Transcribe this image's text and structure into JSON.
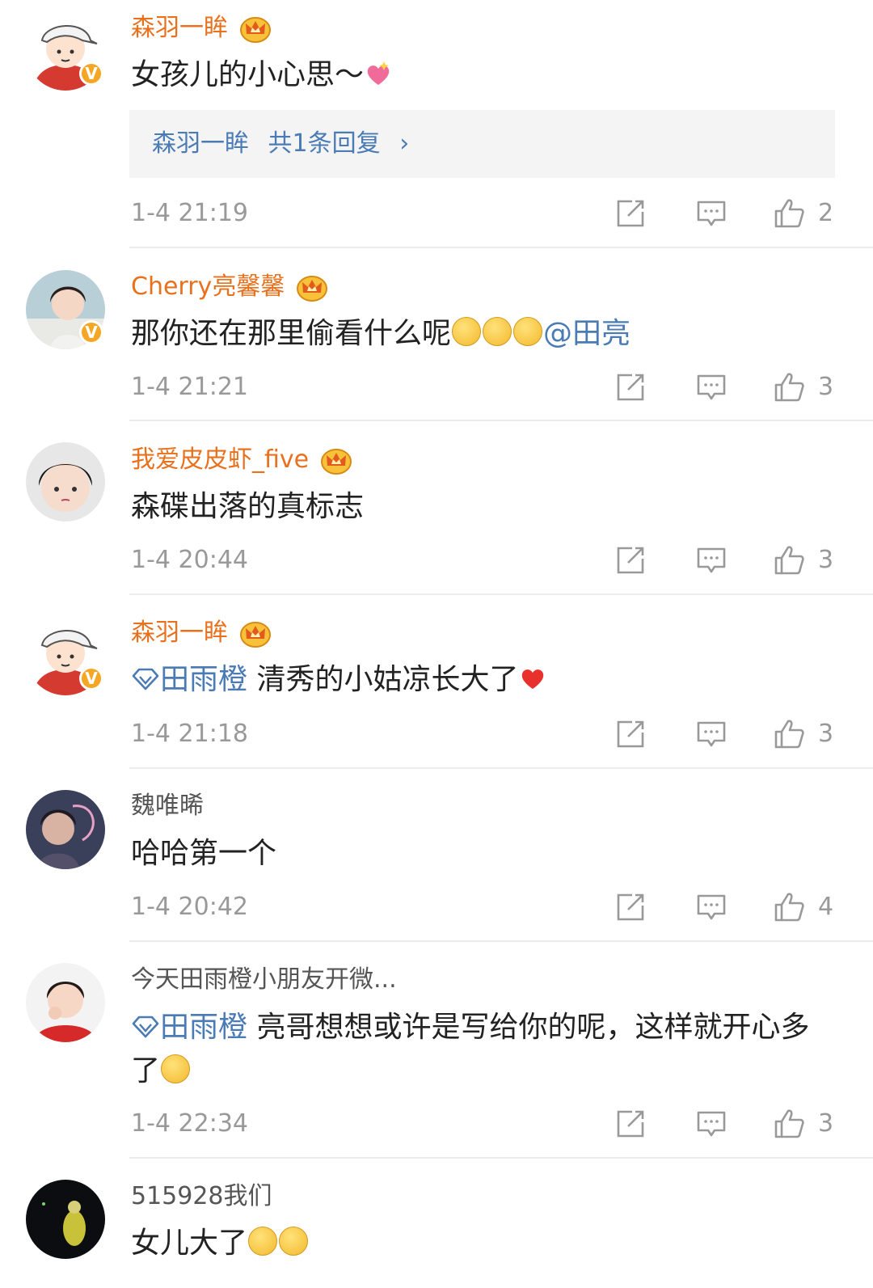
{
  "comments": [
    {
      "name": "森羽一眸",
      "vip": true,
      "text": "女孩儿的小心思～",
      "reply_author": "森羽一眸",
      "reply_count_label": "共1条回复",
      "time": "1-4 21:19",
      "likes": "2"
    },
    {
      "name": "Cherry亮馨馨",
      "vip": true,
      "text": "那你还在那里偷看什么呢",
      "mention": "@田亮",
      "time": "1-4 21:21",
      "likes": "3"
    },
    {
      "name": "我爱皮皮虾_five",
      "vip": true,
      "text": "森碟出落的真标志",
      "time": "1-4 20:44",
      "likes": "3"
    },
    {
      "name": "森羽一眸",
      "vip": true,
      "mention": "田雨橙",
      "text": " 清秀的小姑凉长大了",
      "time": "1-4 21:18",
      "likes": "3"
    },
    {
      "name": "魏唯晞",
      "vip": false,
      "text": "哈哈第一个",
      "time": "1-4 20:42",
      "likes": "4"
    },
    {
      "name": "今天田雨橙小朋友开微...",
      "vip": false,
      "mention": "田雨橙",
      "text": " 亮哥想想或许是写给你的呢，这样就开心多了",
      "time": "1-4 22:34",
      "likes": "3"
    },
    {
      "name": "515928我们",
      "vip": false,
      "text": "女儿大了"
    }
  ],
  "verified_badge": "V",
  "icons": {
    "share": "share-icon",
    "comment": "comment-icon",
    "like": "thumbs-up-icon",
    "crown": "crown-vip-icon"
  },
  "colors": {
    "vip_name": "#e8711e",
    "link": "#4a7bb5",
    "meta": "#999999"
  }
}
